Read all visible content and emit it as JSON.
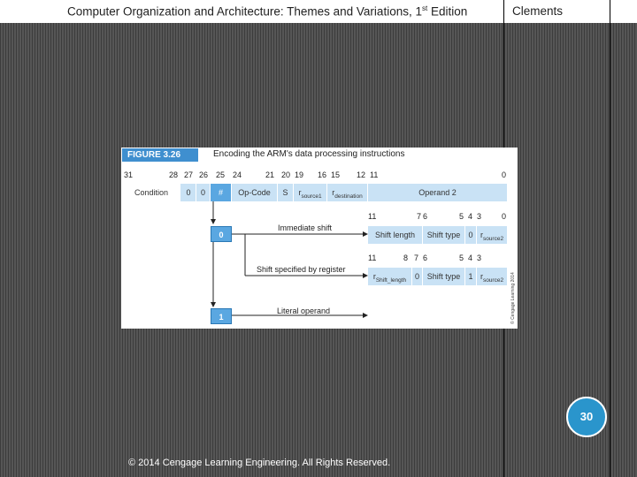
{
  "header": {
    "title": "Computer Organization and Architecture: Themes and Variations, 1",
    "title_sup": "st",
    "title_suffix": " Edition",
    "author": "Clements"
  },
  "figure": {
    "label": "FIGURE 3.26",
    "caption": "Encoding the ARM's data processing instructions",
    "bit_positions": [
      "31",
      "28",
      "27",
      "26",
      "25",
      "24",
      "21",
      "20",
      "19",
      "16",
      "15",
      "12",
      "11",
      "0"
    ],
    "fields": [
      {
        "label": "Condition"
      },
      {
        "label": "0"
      },
      {
        "label": "0"
      },
      {
        "label": "#"
      },
      {
        "label": "Op-Code"
      },
      {
        "label": "S"
      },
      {
        "label": "r",
        "sub": "source1"
      },
      {
        "label": "r",
        "sub": "destination"
      },
      {
        "label": "Operand 2"
      }
    ],
    "immediate_shift": {
      "annotation": "Immediate shift",
      "selector": "0",
      "bits": [
        "11",
        "7",
        "6",
        "5",
        "4",
        "3",
        "0"
      ],
      "fields": [
        {
          "label": "Shift length"
        },
        {
          "label": "Shift type"
        },
        {
          "label": "0"
        },
        {
          "label": "r",
          "sub": "source2"
        }
      ]
    },
    "register_shift": {
      "annotation": "Shift specified by register",
      "bits": [
        "11",
        "8",
        "7",
        "6",
        "5",
        "4",
        "3"
      ],
      "fields": [
        {
          "label": "r",
          "sub": "Shift_length"
        },
        {
          "label": "0"
        },
        {
          "label": "Shift type"
        },
        {
          "label": "1"
        },
        {
          "label": "r",
          "sub": "source2"
        }
      ]
    },
    "literal": {
      "annotation": "Literal operand",
      "selector": "1"
    },
    "side_credit": "© Cengage Learning 2014"
  },
  "footer": {
    "copyright": "© 2014 Cengage Learning Engineering. All Rights Reserved.",
    "page_number": "30"
  },
  "colors": {
    "field_fill": "#c9e2f5",
    "accent": "#5aa7e1",
    "page_badge": "#2a95cc"
  }
}
